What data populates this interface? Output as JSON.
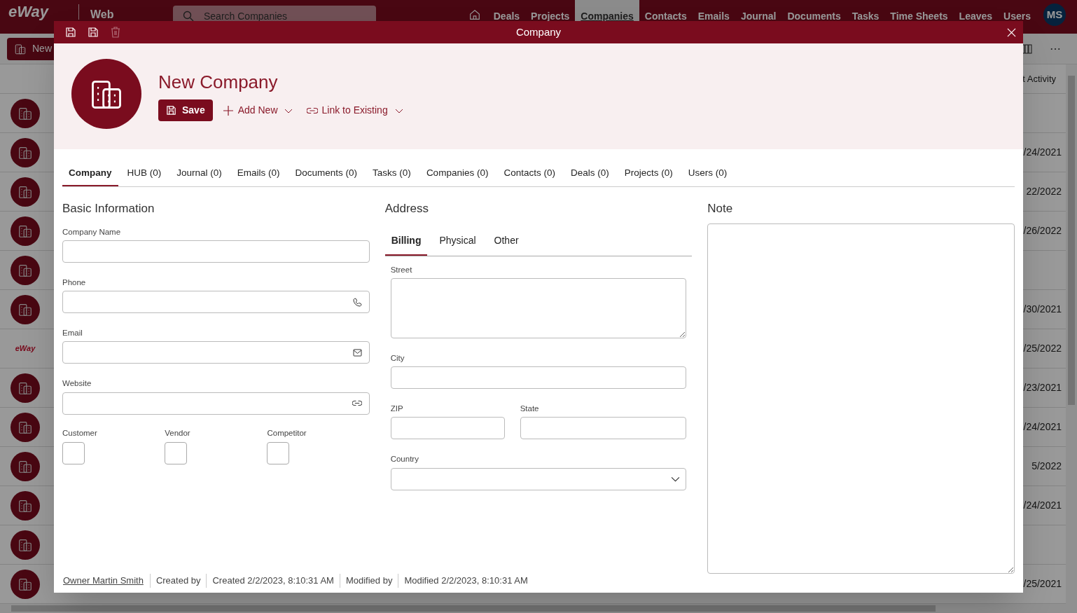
{
  "app": {
    "logo_text": "eWay",
    "section": "Web",
    "search_placeholder": "Search Companies",
    "nav": [
      {
        "label": "Deals",
        "selected": false
      },
      {
        "label": "Projects",
        "selected": false
      },
      {
        "label": "Companies",
        "selected": true
      },
      {
        "label": "Contacts",
        "selected": false
      },
      {
        "label": "Emails",
        "selected": false
      },
      {
        "label": "Journal",
        "selected": false
      },
      {
        "label": "Documents",
        "selected": false
      },
      {
        "label": "Tasks",
        "selected": false
      },
      {
        "label": "Time Sheets",
        "selected": false
      },
      {
        "label": "Leaves",
        "selected": false
      },
      {
        "label": "Users",
        "selected": false
      }
    ],
    "user_initials": "MS",
    "new_button": "New",
    "list": {
      "column_2": "t Activity",
      "rows": [
        {
          "kind": "building"
        },
        {
          "kind": "building",
          "date": "/24/2021"
        },
        {
          "kind": "building",
          "date": "22/2022"
        },
        {
          "kind": "building",
          "date": "/26/2022"
        },
        {
          "kind": "building"
        },
        {
          "kind": "building",
          "date": "/30/2021"
        },
        {
          "kind": "logo",
          "logo_text": "eWay",
          "date": "/25/2022"
        },
        {
          "kind": "building",
          "date": "/23/2021"
        },
        {
          "kind": "building",
          "date": "/24/2021"
        },
        {
          "kind": "building",
          "date": "5/2022"
        },
        {
          "kind": "building",
          "date": "/24/2021"
        },
        {
          "kind": "building"
        },
        {
          "kind": "building",
          "date": "/25/2021"
        }
      ]
    }
  },
  "dialog": {
    "title": "Company",
    "toolbar": [
      {
        "kind": "save-close",
        "disabled": false
      },
      {
        "kind": "save",
        "disabled": false
      },
      {
        "kind": "delete",
        "disabled": true
      }
    ],
    "heading": "New Company",
    "save_button": "Save",
    "add_new": "Add New",
    "link_existing": "Link to Existing",
    "tabs": [
      {
        "label": "Company",
        "selected": true
      },
      {
        "label": "HUB (0)",
        "selected": false
      },
      {
        "label": "Journal (0)",
        "selected": false
      },
      {
        "label": "Emails (0)",
        "selected": false
      },
      {
        "label": "Documents (0)",
        "selected": false
      },
      {
        "label": "Tasks (0)",
        "selected": false
      },
      {
        "label": "Companies (0)",
        "selected": false
      },
      {
        "label": "Contacts (0)",
        "selected": false
      },
      {
        "label": "Deals (0)",
        "selected": false
      },
      {
        "label": "Projects (0)",
        "selected": false
      },
      {
        "label": "Users (0)",
        "selected": false
      }
    ],
    "basic": {
      "title": "Basic Information",
      "fields": [
        {
          "label": "Company Name",
          "kind": "text"
        },
        {
          "label": "Phone",
          "kind": "phone"
        },
        {
          "label": "Email",
          "kind": "email"
        },
        {
          "label": "Website",
          "kind": "link"
        }
      ],
      "checkboxes": [
        {
          "label": "Customer",
          "checked": false
        },
        {
          "label": "Vendor",
          "checked": false
        },
        {
          "label": "Competitor",
          "checked": false
        }
      ]
    },
    "address": {
      "title": "Address",
      "tabs": [
        {
          "label": "Billing",
          "selected": true
        },
        {
          "label": "Physical",
          "selected": false
        },
        {
          "label": "Other",
          "selected": false
        }
      ],
      "street": "Street",
      "city": "City",
      "zip": "ZIP",
      "state": "State",
      "country": "Country"
    },
    "note": {
      "title": "Note"
    },
    "footer": {
      "owner": "Owner Martin Smith",
      "items": [
        "Created by",
        "Created 2/2/2023, 8:10:31 AM",
        "Modified by",
        "Modified 2/2/2023, 8:10:31 AM"
      ]
    }
  }
}
